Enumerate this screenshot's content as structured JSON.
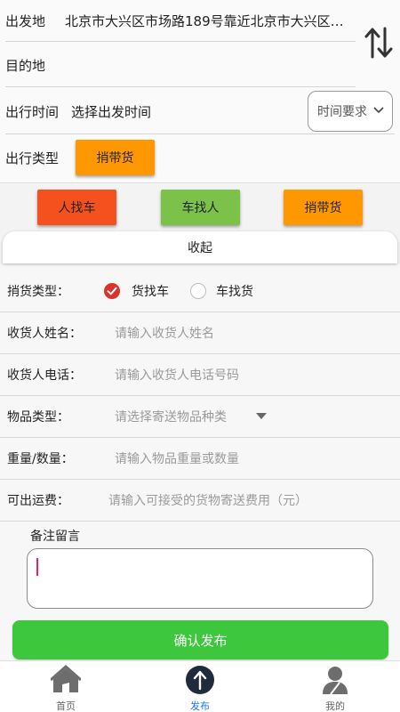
{
  "trip": {
    "origin_label": "出发地",
    "origin_value": "北京市大兴区市场路189号靠近北京市大兴区档...",
    "destination_label": "目的地",
    "destination_value": "",
    "time_label": "出行时间",
    "time_value": "选择出发时间",
    "time_requirement": "时间要求",
    "type_label": "出行类型",
    "type_value": "捎带货"
  },
  "modes": [
    {
      "label": "人找车",
      "color": "#f4511e"
    },
    {
      "label": "车找人",
      "color": "#7cc24a"
    },
    {
      "label": "捎带货",
      "color": "#ff9800"
    }
  ],
  "collapse_label": "收起",
  "form": {
    "cargo_type": {
      "label": "捎货类型：",
      "option_a": "货找车",
      "option_b": "车找货",
      "selected": "货找车"
    },
    "receiver_name": {
      "label": "收货人姓名：",
      "placeholder": "请输入收货人姓名"
    },
    "receiver_phone": {
      "label": "收货人电话：",
      "placeholder": "请输入收货人电话号码"
    },
    "item_type": {
      "label": "物品类型：",
      "placeholder": "请选择寄送物品种类"
    },
    "weight": {
      "label": "重量/数量：",
      "placeholder": "请输入物品重量或数量"
    },
    "fee": {
      "label": "可出运费：",
      "placeholder": "请输入可接受的货物寄送费用（元）"
    },
    "memo_label": "备注留言",
    "memo_value": ""
  },
  "confirm_label": "确认发布",
  "tabs": [
    {
      "label": "首页",
      "icon": "home-icon"
    },
    {
      "label": "发布",
      "icon": "publish-icon",
      "active": true
    },
    {
      "label": "我的",
      "icon": "profile-icon"
    }
  ],
  "colors": {
    "accent_green": "#3cc73c",
    "active_tab": "#1e73e8",
    "radio_on": "#d9342b"
  }
}
